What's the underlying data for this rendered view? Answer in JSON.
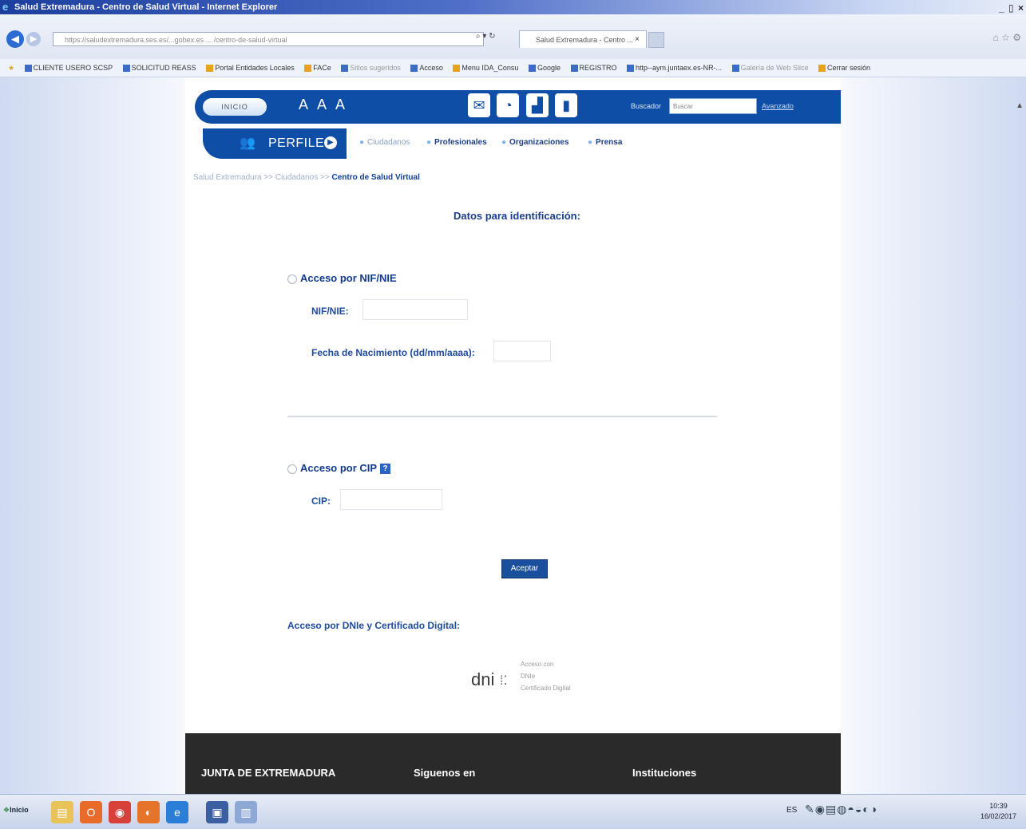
{
  "window": {
    "title": "Salud Extremadura - Centro de Salud Virtual - Internet Explorer",
    "controls": "_ ▯ ×"
  },
  "browser": {
    "url": "https://saludextremadura.ses.es/...gobex.es ... /centro-de-salud-virtual",
    "tab_title": "Salud Extremadura - Centro ...",
    "tab_close": "×"
  },
  "favorites": [
    "CLIENTE USERO SCSP",
    "SOLICITUD REASS",
    "Portal Entidades Locales",
    "FACe",
    "Sitios sugeridos",
    "Acceso",
    "Menu IDA_Consu",
    "Google",
    "REGISTRO",
    "http--aym.juntaex.es-NR-...",
    "Galería de Web Slice",
    "Cerrar sesión"
  ],
  "header": {
    "inicio": "INICIO",
    "font_sizes": "A A A",
    "buscador_label": "Buscador",
    "buscador_placeholder": "Buscar",
    "avanzado": "Avanzado"
  },
  "nav": {
    "perfiles": "PERFILES",
    "items": [
      "Ciudadanos",
      "Profesionales",
      "Organizaciones",
      "Prensa"
    ]
  },
  "breadcrumb": {
    "item1": "Salud Extremadura",
    "sep": " >> ",
    "item2": "Ciudadanos",
    "current": "Centro de Salud Virtual"
  },
  "form": {
    "title": "Datos para identificación:",
    "nif_access": "Acceso por NIF/NIE",
    "nif_label": "NIF/NIE:",
    "nif_value": "",
    "fecha_label": "Fecha de Nacimiento (dd/mm/aaaa):",
    "fecha_value": "",
    "cip_access": "Acceso por CIP",
    "cip_help": "?",
    "cip_label": "CIP:",
    "cip_value": "",
    "aceptar": "Aceptar",
    "dnie_title": "Acceso por DNIe y Certificado Digital:",
    "dnie_logo": "dni",
    "dnie_caption1": "Acceso con",
    "dnie_caption2": "DNIe",
    "dnie_caption3": "Certificado Digital"
  },
  "footer": {
    "junta": "JUNTA DE EXTREMADURA",
    "siguenos": "Siguenos en",
    "instituciones": "Instituciones"
  },
  "taskbar": {
    "start": "Inicio",
    "lang": "ES",
    "time": "10:39",
    "date": "16/02/2017"
  },
  "colors": {
    "primary_blue": "#0e4ea7",
    "text_blue": "#1f4a9c",
    "footer_dark": "#2a2a2a"
  }
}
